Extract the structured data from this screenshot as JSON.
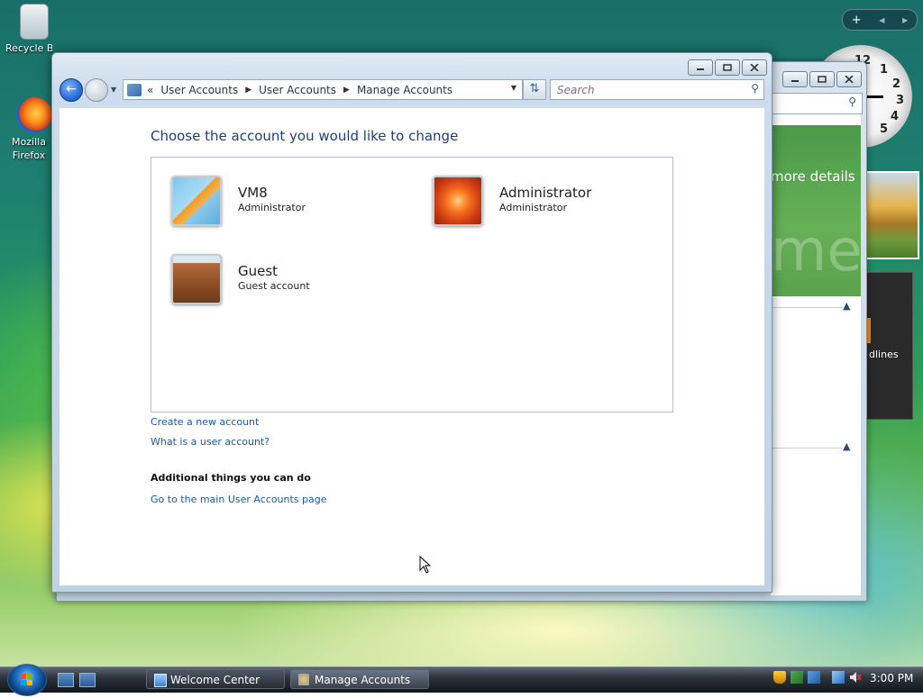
{
  "desktop": {
    "icons": [
      {
        "label": "Recycle Bin"
      },
      {
        "label": "Mozilla Firefox"
      }
    ],
    "clock_numbers": [
      "12",
      "1",
      "2",
      "3",
      "4",
      "5"
    ],
    "gadget_bar": {
      "add": "+",
      "prev": "◀",
      "next": "▶"
    }
  },
  "background_window": {
    "title": "Welcome Center",
    "details_text": "more details",
    "watermark_text": "me",
    "feed_text": "dlines"
  },
  "window": {
    "breadcrumb_overflow": "«",
    "breadcrumb": [
      "User Accounts",
      "User Accounts",
      "Manage Accounts"
    ],
    "search_placeholder": "Search",
    "heading": "Choose the account you would like to change",
    "accounts": [
      {
        "name": "VM8",
        "type": "Administrator"
      },
      {
        "name": "Administrator",
        "type": "Administrator"
      },
      {
        "name": "Guest",
        "type": "Guest account"
      }
    ],
    "links": {
      "create": "Create a new account",
      "what_is": "What is a user account?"
    },
    "additional_heading": "Additional things you can do",
    "additional_links": [
      "Go to the main User Accounts page"
    ]
  },
  "taskbar": {
    "buttons": [
      "Welcome Center",
      "Manage Accounts"
    ],
    "time": "3:00 PM"
  }
}
